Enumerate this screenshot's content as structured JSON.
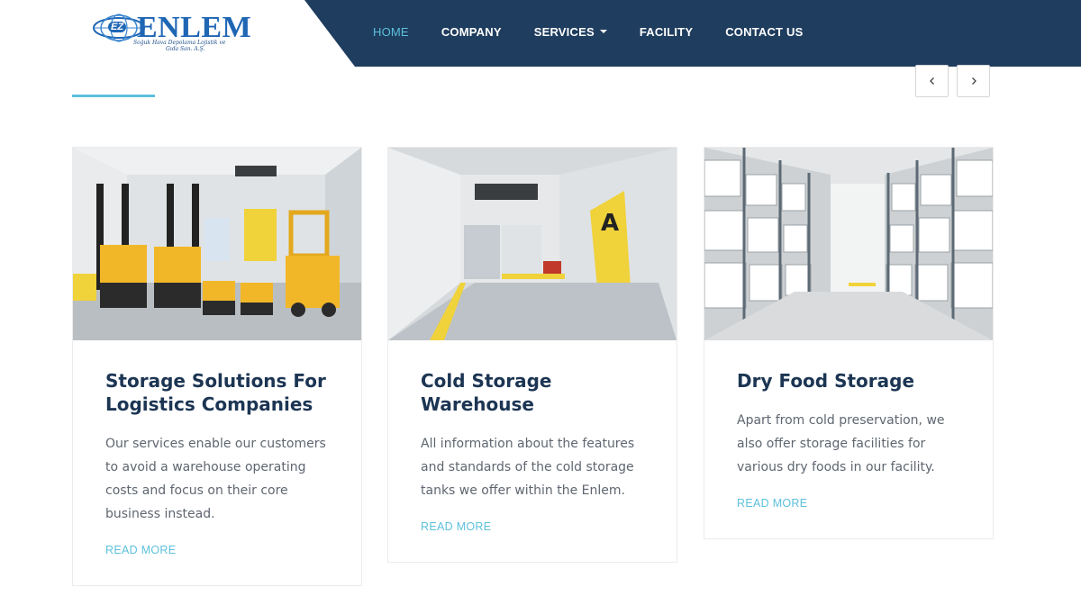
{
  "brand": {
    "name": "ENLEM",
    "badge": "EZ",
    "subtitle_line1": "Soğuk Hava Depolama Lojistik ve",
    "subtitle_line2": "Gıda San. A.Ş."
  },
  "nav": {
    "items": [
      {
        "label": "HOME",
        "active": true
      },
      {
        "label": "COMPANY",
        "active": false
      },
      {
        "label": "SERVICES",
        "active": false,
        "dropdown": true
      },
      {
        "label": "FACILITY",
        "active": false
      },
      {
        "label": "CONTACT US",
        "active": false
      }
    ]
  },
  "slider": {
    "prev_icon": "chevron-left-icon",
    "next_icon": "chevron-right-icon"
  },
  "cards": [
    {
      "title": "Storage Solutions For Logistics Companies",
      "text": "Our services enable our customers to avoid a warehouse operating costs and focus on their core business instead.",
      "link": "READ MORE",
      "image": "forklifts-in-cold-room"
    },
    {
      "title": "Cold Storage Warehouse",
      "text": "All information about the features and standards of the cold storage tanks we offer within the Enlem.",
      "link": "READ MORE",
      "image": "cold-storage-door-a"
    },
    {
      "title": "Dry Food Storage",
      "text": "Apart from cold preservation, we also offer storage facilities for various dry foods in our facility.",
      "link": "READ MORE",
      "image": "pallet-racks-aisle"
    }
  ],
  "colors": {
    "nav_bg": "#1f3d5e",
    "accent": "#5cc1dc",
    "title": "#1c3553",
    "forklift_yellow": "#f2b728"
  }
}
